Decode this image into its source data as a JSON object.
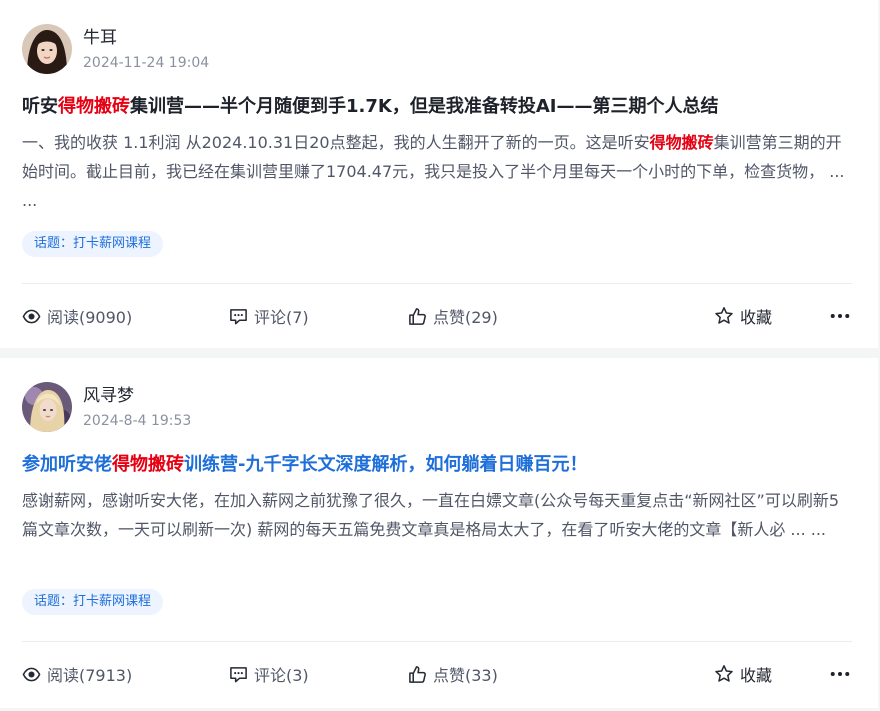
{
  "posts": [
    {
      "author": "牛耳",
      "time": "2024-11-24 19:04",
      "title_pre": "听安",
      "title_kw": "得物搬砖",
      "title_post": "集训营——半个月随便到手1.7K，但是我准备转投AI——第三期个人总结",
      "excerpt_pre": "一、我的收获 1.1利润 从2024.10.31日20点整起，我的人生翻开了新的一页。这是听安",
      "excerpt_kw": "得物搬砖",
      "excerpt_post": "集训营第三期的开始时间。截止目前，我已经在集训营里赚了1704.47元，我只是投入了半个月里每天一个小时的下单，检查货物， ... ...",
      "topic": "话题：打卡薪网课程",
      "read": "阅读(9090)",
      "comment": "评论(7)",
      "like": "点赞(29)",
      "fav": "收藏"
    },
    {
      "author": "风寻梦",
      "time": "2024-8-4 19:53",
      "title_pre": "参加听安佬",
      "title_kw": "得物搬砖",
      "title_post": "训练营-九千字长文深度解析，如何躺着日赚百元！",
      "excerpt": "感谢薪网，感谢听安大佬，在加入薪网之前犹豫了很久，一直在白嫖文章(公众号每天重复点击“新网社区”可以刷新5篇文章次数，一天可以刷新一次) 薪网的每天五篇免费文章真是格局太大了，在看了听安大佬的文章【新人必 ... ...",
      "topic": "话题：打卡薪网课程",
      "read": "阅读(7913)",
      "comment": "评论(3)",
      "like": "点赞(33)",
      "fav": "收藏"
    }
  ],
  "colors": {
    "keyword": "#e60012",
    "link_title": "#1e6fd9",
    "topic_bg": "#eef4ff"
  },
  "icons": [
    "eye-icon",
    "comment-icon",
    "thumbs-up-icon",
    "star-icon",
    "more-icon"
  ]
}
